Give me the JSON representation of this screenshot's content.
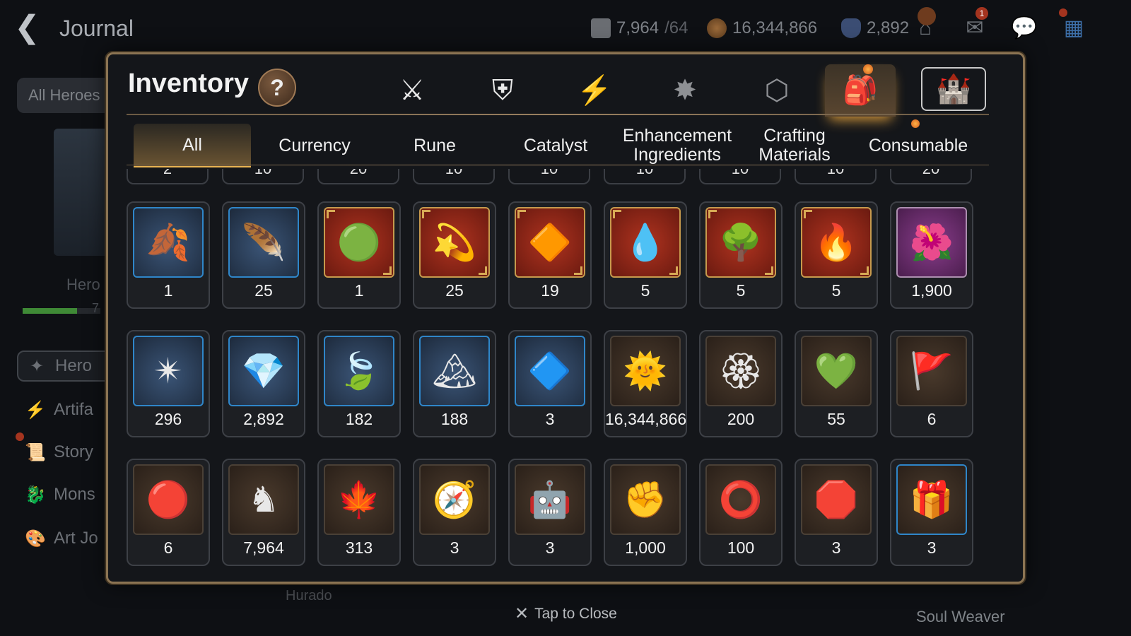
{
  "background": {
    "title": "Journal",
    "resources": [
      {
        "icon": "horse-token-icon",
        "value": "7,964",
        "suffix": "/64"
      },
      {
        "icon": "gold-coin-icon",
        "value": "16,344,866"
      },
      {
        "icon": "blue-gem-icon",
        "value": "2,892"
      }
    ],
    "top_icons": [
      "pet-house-icon",
      "mail-icon",
      "chat-icon",
      "menu-grid-icon"
    ],
    "mail_badge": "1",
    "filter_button": "All Heroes",
    "hero_label": "Hero",
    "hero_progress": 0.7,
    "hero_progress_text": "7",
    "sidebar": [
      {
        "icon": "hero-icon",
        "label": "Hero"
      },
      {
        "icon": "artifact-icon",
        "label": "Artifa"
      },
      {
        "icon": "story-icon",
        "label": "Story"
      },
      {
        "icon": "monster-icon",
        "label": "Mons"
      },
      {
        "icon": "art-journal-icon",
        "label": "Art Jo"
      }
    ],
    "bottom_label": "Hurado",
    "bottom_right_label": "Soul Weaver"
  },
  "modal": {
    "title": "Inventory",
    "help_label": "?",
    "category_icons": [
      {
        "name": "hero-gear-icon",
        "glyph": "⚔"
      },
      {
        "name": "shield-sword-icon",
        "glyph": "⛨"
      },
      {
        "name": "lightning-icon",
        "glyph": "⚡"
      },
      {
        "name": "rune-burst-icon",
        "glyph": "✸"
      },
      {
        "name": "cube-icon",
        "glyph": "⬡"
      },
      {
        "name": "bag-icon",
        "glyph": "🎒"
      },
      {
        "name": "guild-castle-icon",
        "glyph": "🏰"
      }
    ],
    "tabs": [
      {
        "label": "All"
      },
      {
        "label": "Currency"
      },
      {
        "label": "Rune"
      },
      {
        "label": "Catalyst"
      },
      {
        "label": "Enhancement Ingredients"
      },
      {
        "label": "Crafting Materials"
      },
      {
        "label": "Consumable"
      }
    ],
    "partial_row": [
      "2",
      "10",
      "20",
      "10",
      "10",
      "10",
      "10",
      "10",
      "20"
    ],
    "items": [
      [
        {
          "icon": "golden-leaf-emblem-icon",
          "qty": "1",
          "frame": "blue"
        },
        {
          "icon": "feather-berry-icon",
          "qty": "25",
          "frame": "blue"
        },
        {
          "icon": "green-orb-icon",
          "qty": "1",
          "frame": "red"
        },
        {
          "icon": "galaxy-ring-icon",
          "qty": "25",
          "frame": "red"
        },
        {
          "icon": "amber-crystal-icon",
          "qty": "19",
          "frame": "red"
        },
        {
          "icon": "water-drop-necklace-icon",
          "qty": "5",
          "frame": "red"
        },
        {
          "icon": "tree-necklace-icon",
          "qty": "5",
          "frame": "red"
        },
        {
          "icon": "fire-necklace-icon",
          "qty": "5",
          "frame": "red"
        },
        {
          "icon": "flower-ring-icon",
          "qty": "1,900",
          "frame": "purple"
        }
      ],
      [
        {
          "icon": "star-compass-icon",
          "qty": "296",
          "frame": "blue"
        },
        {
          "icon": "crystal-gem-icon",
          "qty": "2,892",
          "frame": "blue"
        },
        {
          "icon": "green-leaf-icon",
          "qty": "182",
          "frame": "blue"
        },
        {
          "icon": "pink-mountain-icon",
          "qty": "188",
          "frame": "blue"
        },
        {
          "icon": "cyan-crystal-icon",
          "qty": "3",
          "frame": "blue"
        },
        {
          "icon": "sun-coin-icon",
          "qty": "16,344,866",
          "frame": "brown"
        },
        {
          "icon": "golden-seal-icon",
          "qty": "200",
          "frame": "brown"
        },
        {
          "icon": "green-heart-icon",
          "qty": "55",
          "frame": "brown"
        },
        {
          "icon": "war-banner-icon",
          "qty": "6",
          "frame": "brown"
        }
      ],
      [
        {
          "icon": "lava-orb-icon",
          "qty": "6",
          "frame": "brown"
        },
        {
          "icon": "horse-token-icon",
          "qty": "7,964",
          "frame": "brown"
        },
        {
          "icon": "red-leaves-icon",
          "qty": "313",
          "frame": "brown"
        },
        {
          "icon": "stone-compass-icon",
          "qty": "3",
          "frame": "brown"
        },
        {
          "icon": "robot-pet-icon",
          "qty": "3",
          "frame": "brown"
        },
        {
          "icon": "fist-emblem-icon",
          "qty": "1,000",
          "frame": "brown"
        },
        {
          "icon": "red-bracelet-icon",
          "qty": "100",
          "frame": "brown"
        },
        {
          "icon": "red-badge-icon",
          "qty": "3",
          "frame": "brown"
        },
        {
          "icon": "jewel-box-icon",
          "qty": "3",
          "frame": "blue-b"
        }
      ]
    ],
    "glyphs": {
      "golden-leaf-emblem-icon": "🍂",
      "feather-berry-icon": "🪶",
      "green-orb-icon": "🟢",
      "galaxy-ring-icon": "💫",
      "amber-crystal-icon": "🔶",
      "water-drop-necklace-icon": "💧",
      "tree-necklace-icon": "🌳",
      "fire-necklace-icon": "🔥",
      "flower-ring-icon": "🌺",
      "star-compass-icon": "✴",
      "crystal-gem-icon": "💎",
      "green-leaf-icon": "🍃",
      "pink-mountain-icon": "🏔",
      "cyan-crystal-icon": "🔷",
      "sun-coin-icon": "🌞",
      "golden-seal-icon": "🏵",
      "green-heart-icon": "💚",
      "war-banner-icon": "🚩",
      "lava-orb-icon": "🔴",
      "horse-token-icon": "♞",
      "red-leaves-icon": "🍁",
      "stone-compass-icon": "🧭",
      "robot-pet-icon": "🤖",
      "fist-emblem-icon": "✊",
      "red-bracelet-icon": "⭕",
      "red-badge-icon": "🛑",
      "jewel-box-icon": "🎁"
    },
    "close_hint": "Tap to Close"
  }
}
